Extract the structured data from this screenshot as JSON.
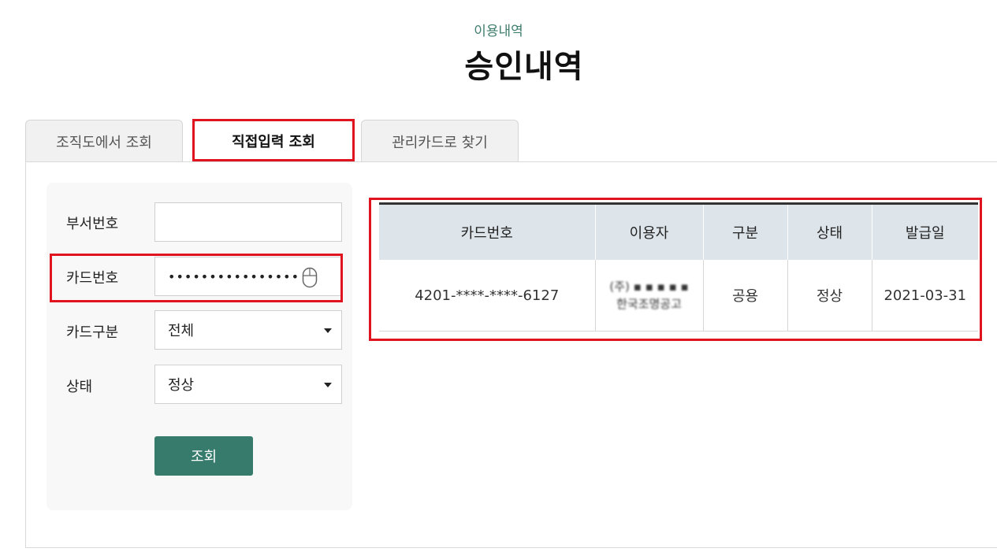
{
  "header": {
    "subtitle": "이용내역",
    "title": "승인내역"
  },
  "tabs": [
    {
      "label": "조직도에서 조회"
    },
    {
      "label": "직접입력 조회"
    },
    {
      "label": "관리카드로 찾기"
    }
  ],
  "form": {
    "dept_label": "부서번호",
    "dept_value": "",
    "card_label": "카드번호",
    "card_value": "••••••••••••••••",
    "type_label": "카드구분",
    "type_value": "전체",
    "status_label": "상태",
    "status_value": "정상",
    "search_label": "조회"
  },
  "table": {
    "headers": [
      "카드번호",
      "이용자",
      "구분",
      "상태",
      "발급일"
    ],
    "rows": [
      {
        "card": "4201-****-****-6127",
        "user_line1": "(주) ▪ ▪ ▪ ▪ ▪",
        "user_line2": "한국조명공고",
        "type": "공용",
        "status": "정상",
        "issued": "2021-03-31"
      }
    ]
  },
  "colors": {
    "accent": "#367b6c",
    "highlight": "#e0141e",
    "header_bg": "#dde5ea"
  }
}
